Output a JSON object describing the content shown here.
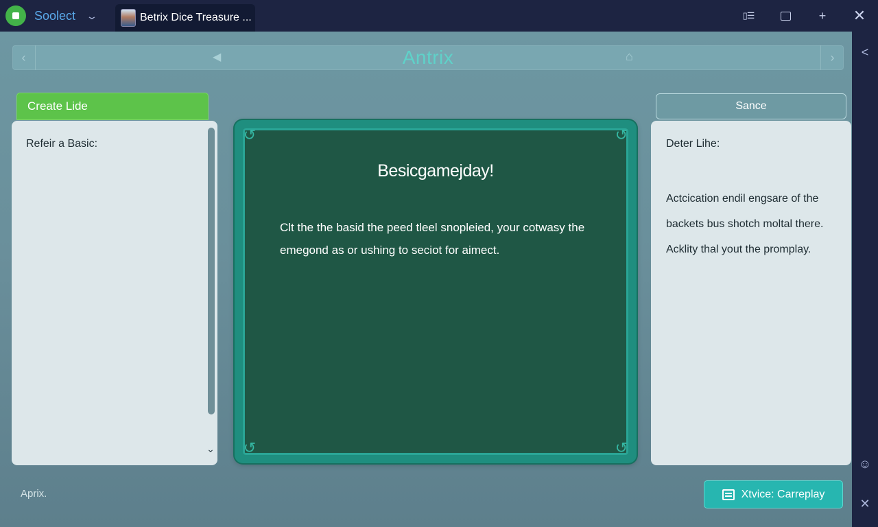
{
  "titlebar": {
    "app_name": "Soolect",
    "app_chevron": "⌄",
    "tab_title": "Betrix Dice Treasure ...",
    "controls": {
      "menu": "▯☰",
      "add": "+",
      "close": "✕"
    }
  },
  "nav": {
    "title": "Antrix",
    "prev_arrow": "‹",
    "next_arrow": "›",
    "back_arrow": "◀",
    "home_icon": "⌂"
  },
  "left": {
    "create_button": "Create Lide",
    "panel_heading": "Refeir a Basic:",
    "scroll_down": "⌄"
  },
  "board": {
    "title": "Besicgamejday!",
    "text": "Clt the the basid the peed tleel snopleied, your cotwasy the emegond as or ushing to seciot for aimect.",
    "corner_glyph": "↺"
  },
  "right": {
    "sance_button": "Sance",
    "panel_heading": "Deter Lihe:",
    "lines": [
      "Actcication endil engsare of the",
      "backets bus shotch moltal there.",
      "Acklity thal yout the promplay."
    ]
  },
  "footer": {
    "label": "Aprix.",
    "practice_button": "Xtvice: Carreplay"
  },
  "rail": {
    "collapse": "<",
    "chat": "☺",
    "close": "✕"
  },
  "colors": {
    "accent_green": "#5dc34a",
    "board_green": "#1f5745",
    "teal_button": "#27b6b0",
    "title_teal": "#5fd2c9"
  }
}
